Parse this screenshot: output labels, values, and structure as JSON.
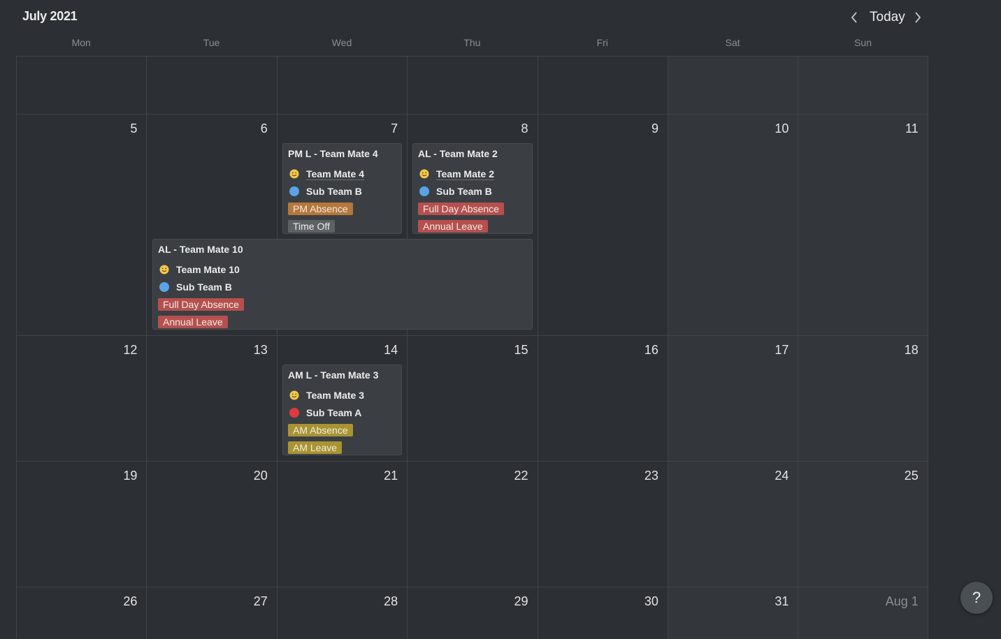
{
  "header": {
    "title": "July 2021",
    "today_label": "Today",
    "prev_icon": "chevron-left-icon",
    "next_icon": "chevron-right-icon"
  },
  "weekdays": [
    "Mon",
    "Tue",
    "Wed",
    "Thu",
    "Fri",
    "Sat",
    "Sun"
  ],
  "weeks": [
    {
      "days": [
        "",
        "",
        "",
        "",
        "",
        "",
        ""
      ]
    },
    {
      "days": [
        "5",
        "6",
        "7",
        "8",
        "9",
        "10",
        "11"
      ]
    },
    {
      "days": [
        "12",
        "13",
        "14",
        "15",
        "16",
        "17",
        "18"
      ]
    },
    {
      "days": [
        "19",
        "20",
        "21",
        "22",
        "23",
        "24",
        "25"
      ]
    },
    {
      "days": [
        "26",
        "27",
        "28",
        "29",
        "30",
        "31",
        "Aug 1"
      ]
    }
  ],
  "events": [
    {
      "title": "PM L - Team Mate 4",
      "person": "Team Mate 4",
      "team": "Sub Team B",
      "team_color": "#5aa3e6",
      "tags": [
        {
          "label": "PM Absence",
          "color": "#b5773c"
        },
        {
          "label": "Time Off",
          "color": "#5c6166"
        }
      ]
    },
    {
      "title": "AL - Team Mate 2",
      "person": "Team Mate 2",
      "team": "Sub Team B",
      "team_color": "#5aa3e6",
      "tags": [
        {
          "label": "Full Day Absence",
          "color": "#b5504f"
        },
        {
          "label": "Annual Leave",
          "color": "#b5504f"
        }
      ]
    },
    {
      "title": "AL - Team Mate 10",
      "person": "Team Mate 10",
      "team": "Sub Team B",
      "team_color": "#5aa3e6",
      "tags": [
        {
          "label": "Full Day Absence",
          "color": "#b5504f"
        },
        {
          "label": "Annual Leave",
          "color": "#b5504f"
        }
      ]
    },
    {
      "title": "AM L - Team Mate 3",
      "person": "Team Mate 3",
      "team": "Sub Team A",
      "team_color": "#e03a3e",
      "tags": [
        {
          "label": "AM Absence",
          "color": "#a99432"
        },
        {
          "label": "AM Leave",
          "color": "#a99432"
        }
      ]
    }
  ],
  "help": {
    "label": "?"
  }
}
